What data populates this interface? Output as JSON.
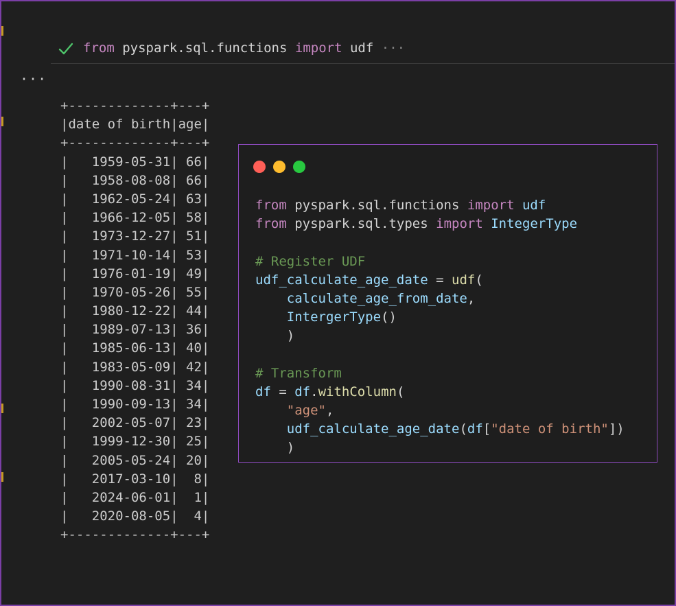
{
  "cell": {
    "kw_from": "from",
    "module": "pyspark.sql.functions",
    "kw_import": "import",
    "name": "udf",
    "ellipsis": "···"
  },
  "output_more": "···",
  "table": {
    "border": "+-------------+---+",
    "header": "|date of birth|age|",
    "rows": [
      "|   1959-05-31| 66|",
      "|   1958-08-08| 66|",
      "|   1962-05-24| 63|",
      "|   1966-12-05| 58|",
      "|   1973-12-27| 51|",
      "|   1971-10-14| 53|",
      "|   1976-01-19| 49|",
      "|   1970-05-26| 55|",
      "|   1980-12-22| 44|",
      "|   1989-07-13| 36|",
      "|   1985-06-13| 40|",
      "|   1983-05-09| 42|",
      "|   1990-08-31| 34|",
      "|   1990-09-13| 34|",
      "|   2002-05-07| 23|",
      "|   1999-12-30| 25|",
      "|   2005-05-24| 20|",
      "|   2017-03-10|  8|",
      "|   2024-06-01|  1|",
      "|   2020-08-05|  4|"
    ]
  },
  "snippet": {
    "l1_from": "from",
    "l1_mod": "pyspark.sql.functions",
    "l1_import": "import",
    "l1_name": "udf",
    "l2_from": "from",
    "l2_mod": "pyspark.sql.types",
    "l2_import": "import",
    "l2_name": "IntegerType",
    "c1": "# Register UDF",
    "l4_var": "udf_calculate_age_date",
    "l4_eq": " = ",
    "l4_fn": "udf",
    "l4_paren": "(",
    "l5_arg": "calculate_age_from_date",
    "l5_comma": ",",
    "l6_type": "IntergerType",
    "l6_paren": "()",
    "l7_close": ")",
    "c2": "# Transform",
    "l9_var": "df",
    "l9_eq": " = ",
    "l9_obj": "df",
    "l9_dot": ".",
    "l9_fn": "withColumn",
    "l9_paren": "(",
    "l10_str": "\"age\"",
    "l10_comma": ",",
    "l11_fn": "udf_calculate_age_date",
    "l11_open": "(",
    "l11_obj": "df",
    "l11_br_open": "[",
    "l11_str": "\"date of birth\"",
    "l11_br_close": "])",
    "l12_close": ")"
  },
  "colors": {
    "frame_border": "#7b3fa6",
    "background": "#1f1f1f",
    "check": "#4ec36a",
    "traffic_red": "#ff5f57",
    "traffic_yellow": "#febc2e",
    "traffic_green": "#28c840"
  }
}
